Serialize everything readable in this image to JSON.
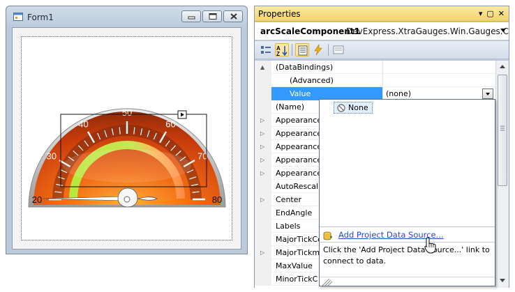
{
  "form": {
    "title": "Form1",
    "icon": "form-icon",
    "caption_buttons": [
      "minimize-icon",
      "maximize-icon",
      "close-icon"
    ],
    "gauge": {
      "scale_labels": [
        "20",
        "30",
        "40",
        "50",
        "60",
        "70",
        "80"
      ],
      "min": 20,
      "max": 80,
      "value": 20,
      "range_start_color": "#b6e83a",
      "range_end_color": "#ff9a55",
      "body_color": "#e8561a"
    }
  },
  "properties": {
    "title": "Properties",
    "title_icons": [
      "pin-icon",
      "window-icon",
      "close-icon"
    ],
    "component_name": "arcScaleComponent1",
    "component_type": "DevExpress.XtraGauges.Win.Gauges.Circu",
    "toolbar": [
      "categorized-icon",
      "alphabetical-icon",
      "properties-icon",
      "events-icon",
      "property-pages-icon"
    ],
    "rows": [
      {
        "name": "(DataBindings)",
        "value": "",
        "expander": "▲",
        "indent": 0
      },
      {
        "name": "(Advanced)",
        "value": "",
        "expander": "",
        "indent": 1
      },
      {
        "name": "Value",
        "value": "(none)",
        "expander": "",
        "indent": 1,
        "selected": true
      },
      {
        "name": "(Name)",
        "value": "",
        "expander": "",
        "indent": 0
      },
      {
        "name": "Appearance",
        "value": "",
        "expander": "▷",
        "indent": 0
      },
      {
        "name": "Appearance",
        "value": "",
        "expander": "▷",
        "indent": 0
      },
      {
        "name": "Appearance",
        "value": "",
        "expander": "▷",
        "indent": 0
      },
      {
        "name": "Appearance",
        "value": "",
        "expander": "▷",
        "indent": 0
      },
      {
        "name": "Appearance",
        "value": "",
        "expander": "▷",
        "indent": 0
      },
      {
        "name": "AutoRescali",
        "value": "",
        "expander": "",
        "indent": 0
      },
      {
        "name": "Center",
        "value": "",
        "expander": "▷",
        "indent": 0
      },
      {
        "name": "EndAngle",
        "value": "",
        "expander": "",
        "indent": 0
      },
      {
        "name": "Labels",
        "value": "",
        "expander": "",
        "indent": 0
      },
      {
        "name": "MajorTickCo",
        "value": "",
        "expander": "",
        "indent": 0
      },
      {
        "name": "MajorTickm",
        "value": "",
        "expander": "▷",
        "indent": 0
      },
      {
        "name": "MaxValue",
        "value": "",
        "expander": "",
        "indent": 0
      },
      {
        "name": "MinorTickC",
        "value": "",
        "expander": "",
        "indent": 0
      }
    ]
  },
  "popup": {
    "none_label": "None",
    "link_label": "Add Project Data Source...",
    "description": "Click the 'Add Project Data Source...' link to connect to data."
  }
}
